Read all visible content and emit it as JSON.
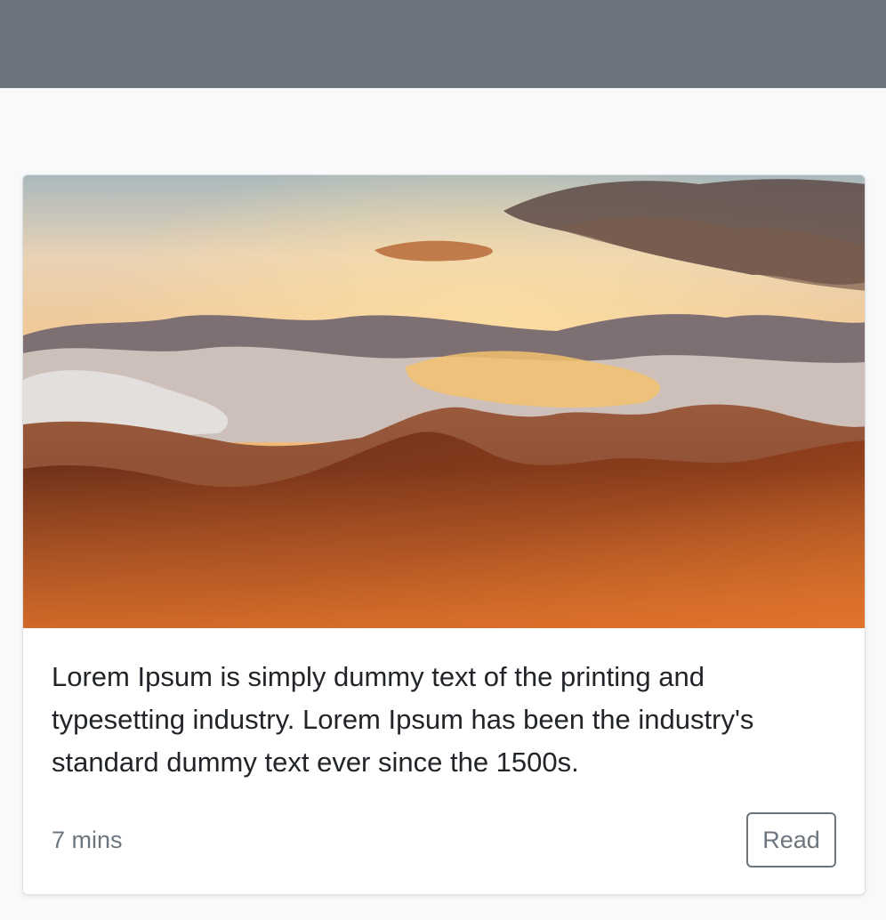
{
  "card": {
    "image_alt": "Mountain range at sunset above the clouds",
    "text": "Lorem Ipsum is simply dummy text of the printing and typesetting industry. Lorem Ipsum has been the industry's standard dummy text ever since the 1500s.",
    "read_time": "7 mins",
    "read_label": "Read"
  },
  "colors": {
    "topbar": "#6c757d",
    "page_background": "#f8f9fa",
    "secondary": "#6c757d"
  }
}
